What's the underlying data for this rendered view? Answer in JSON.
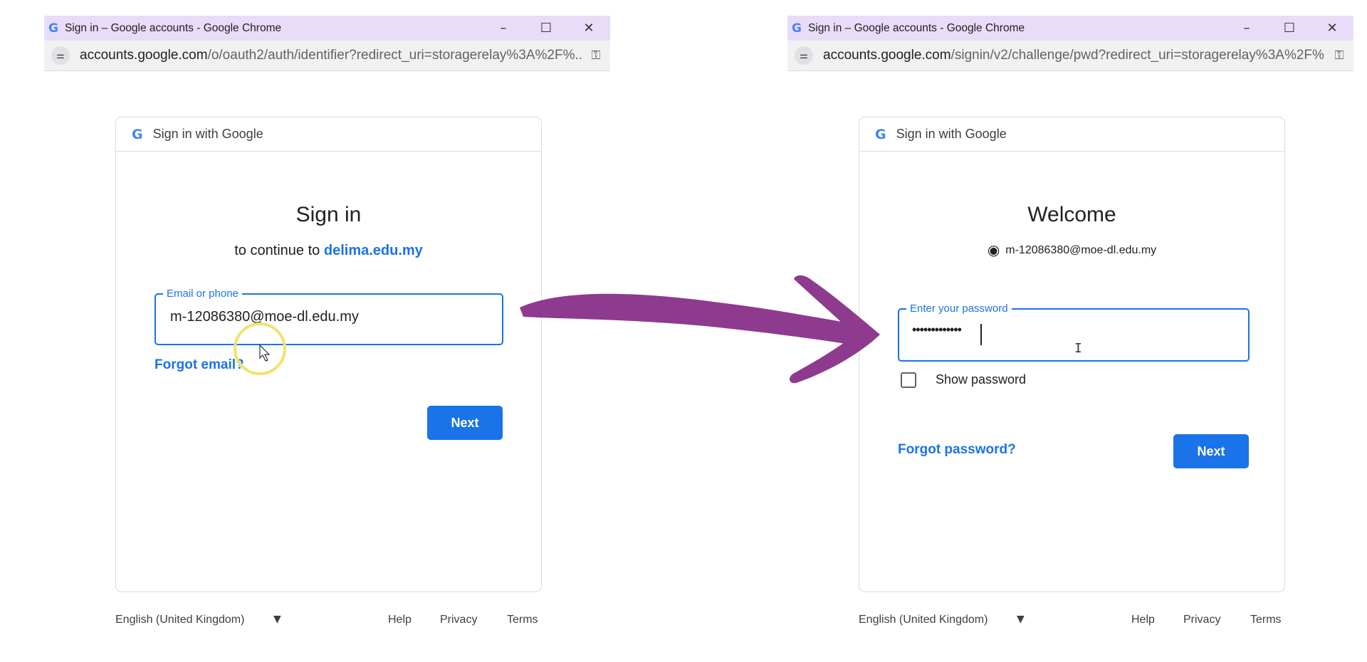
{
  "left": {
    "window_title": "Sign in – Google accounts - Google Chrome",
    "controls": {
      "minimize": "–",
      "maximize": "☐",
      "close": "✕"
    },
    "url_host": "accounts.google.com",
    "url_path": "/o/oauth2/auth/identifier?redirect_uri=storagerelay%3A%2F%...",
    "card_header": "Sign in with Google",
    "heading": "Sign in",
    "subtitle_prefix": "to continue to ",
    "subtitle_link": "delima.edu.my",
    "field_label": "Email or phone",
    "field_value": "m-12086380@moe-dl.edu.my",
    "forgot_link": "Forgot email?",
    "next_button": "Next",
    "footer": {
      "language": "English (United Kingdom)",
      "help": "Help",
      "privacy": "Privacy",
      "terms": "Terms"
    }
  },
  "right": {
    "window_title": "Sign in – Google accounts - Google Chrome",
    "controls": {
      "minimize": "–",
      "maximize": "☐",
      "close": "✕"
    },
    "url_host": "accounts.google.com",
    "url_path": "/signin/v2/challenge/pwd?redirect_uri=storagerelay%3A%2F%...",
    "card_header": "Sign in with Google",
    "heading": "Welcome",
    "account_email": "m-12086380@moe-dl.edu.my",
    "field_label": "Enter your password",
    "field_value": "•••••••••••••",
    "show_password_label": "Show password",
    "forgot_link": "Forgot password?",
    "next_button": "Next",
    "footer": {
      "language": "English (United Kingdom)",
      "help": "Help",
      "privacy": "Privacy",
      "terms": "Terms"
    }
  },
  "icons": {
    "google_g": "G",
    "site_settings": "⚌",
    "key": "⚿",
    "account_circle": "◉",
    "caret_down": "▼"
  },
  "colors": {
    "titlebar": "#e8dcf8",
    "accent": "#1a73e8",
    "arrow": "#8e3a8f",
    "cursor_highlight": "#f0e36b"
  }
}
